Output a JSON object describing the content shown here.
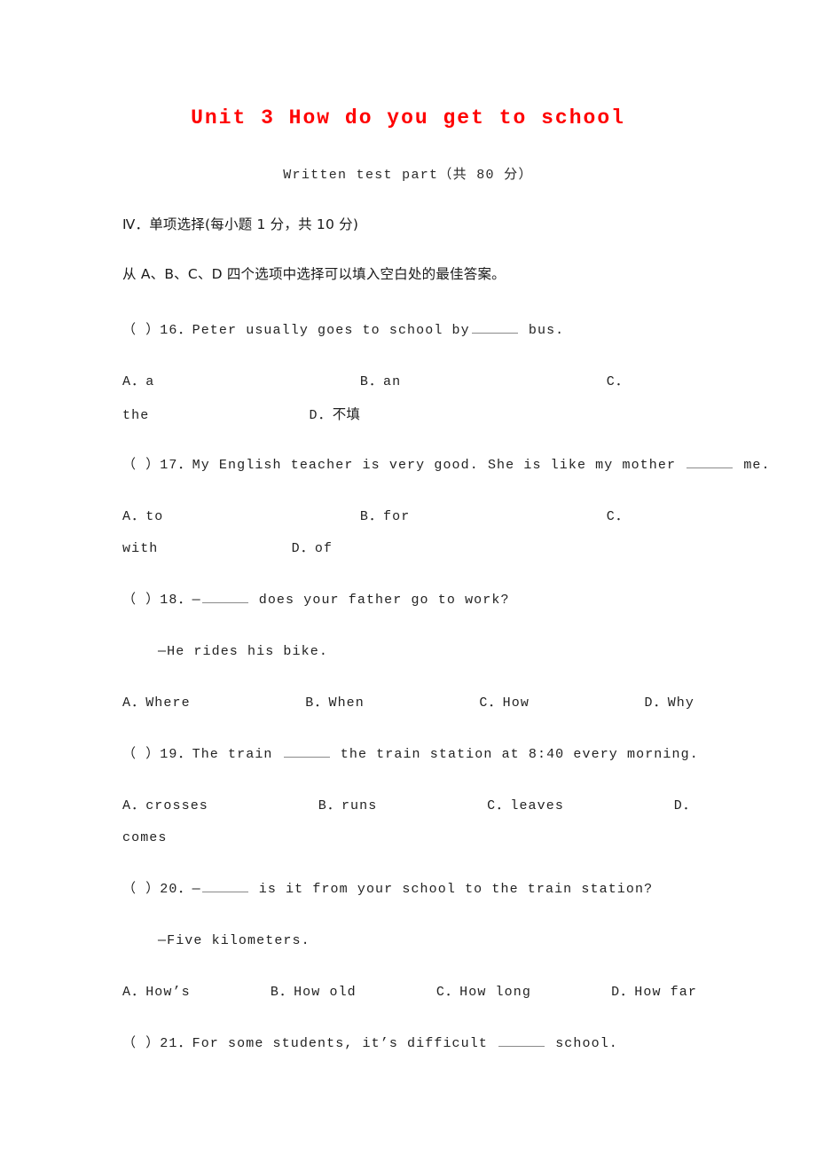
{
  "document": {
    "title": "Unit 3 How do you get to school",
    "title_color": "#ff0000",
    "subtitle": "Written test part（共 80 分）",
    "section_heading": "Ⅳ．单项选择(每小题 1 分，共 10 分)",
    "instruction": "从 A、B、C、D 四个选项中选择可以填入空白处的最佳答案。"
  },
  "questions": [
    {
      "number": "16",
      "marker": "（   ）16．",
      "stem_before": "Peter usually goes to school by",
      "stem_after": "bus.",
      "options": [
        {
          "label": "A．",
          "text": "a"
        },
        {
          "label": "B．",
          "text": "an"
        },
        {
          "label": "C．",
          "text": "the"
        },
        {
          "label": "D．",
          "text": "不填"
        }
      ]
    },
    {
      "number": "17",
      "marker": "（   ）17．",
      "stem_before": "My English teacher is very good. She is like my mother",
      "stem_after": "me.",
      "options": [
        {
          "label": "A．",
          "text": "to"
        },
        {
          "label": "B．",
          "text": "for"
        },
        {
          "label": "C．",
          "text": "with"
        },
        {
          "label": "D．",
          "text": "of"
        }
      ]
    },
    {
      "number": "18",
      "marker": "（   ）18．",
      "stem_before": "—",
      "stem_after": "does your father go to work?",
      "answer_line": "—He rides his bike.",
      "options": [
        {
          "label": "A．",
          "text": "Where"
        },
        {
          "label": "B．",
          "text": "When"
        },
        {
          "label": "C．",
          "text": "How"
        },
        {
          "label": "D．",
          "text": "Why"
        }
      ]
    },
    {
      "number": "19",
      "marker": "（   ）19．",
      "stem_before": "The train",
      "stem_after": "the train station at 8:40 every morning.",
      "options": [
        {
          "label": "A．",
          "text": "crosses"
        },
        {
          "label": "B．",
          "text": "runs"
        },
        {
          "label": "C．",
          "text": "leaves"
        },
        {
          "label": "D．",
          "text": "comes"
        }
      ]
    },
    {
      "number": "20",
      "marker": "（   ）20．",
      "stem_before": "—",
      "stem_after": "is it from your school to the train station?",
      "answer_line": "—Five kilometers.",
      "options": [
        {
          "label": "A．",
          "text": "How’s"
        },
        {
          "label": "B．",
          "text": "How old"
        },
        {
          "label": "C．",
          "text": "How long"
        },
        {
          "label": "D．",
          "text": "How far"
        }
      ]
    },
    {
      "number": "21",
      "marker": "（   ）21．",
      "stem_before": "For some students, it’s difficult",
      "stem_after": "school.",
      "options": []
    }
  ]
}
